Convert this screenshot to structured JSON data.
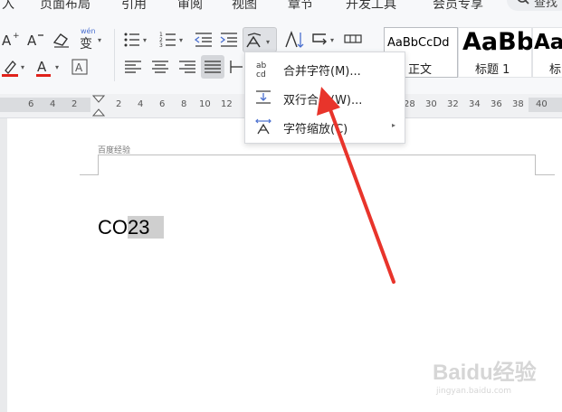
{
  "menu": {
    "items": [
      "入",
      "页面布局",
      "引用",
      "审阅",
      "视图",
      "章节",
      "开发工具",
      "会员专享"
    ],
    "search_label": "查找"
  },
  "toolbar": {
    "wen_label": "wén",
    "wen_char": "变",
    "icons": [
      "font-grow-icon",
      "font-shrink-icon",
      "clear-format-icon",
      "phonetic-guide-icon",
      "bullet-list-icon",
      "numbered-list-icon",
      "decrease-indent-icon",
      "increase-indent-icon",
      "chinese-layout-icon",
      "sort-icon",
      "line-spacing-icon",
      "table-icon",
      "highlight-icon",
      "font-color-icon",
      "char-border-icon",
      "align-left-icon",
      "align-center-icon",
      "align-right-icon",
      "justify-icon",
      "distributed-icon"
    ],
    "font_color": "#e0211a",
    "highlight_color": "#e0211a"
  },
  "styles": [
    {
      "preview": "AaBbCcDd",
      "name": "正文"
    },
    {
      "preview": "AaBb",
      "name": "标题 1"
    },
    {
      "preview": "Aa",
      "name": "标"
    }
  ],
  "ruler": {
    "numbers": [
      "6",
      "4",
      "2",
      "2",
      "4",
      "6",
      "8",
      "10",
      "12",
      "28",
      "30",
      "32",
      "34",
      "36",
      "38",
      "40"
    ]
  },
  "document": {
    "header_label": "百度经验",
    "text_plain": "CO",
    "text_highlighted": "23"
  },
  "dropdown": {
    "items": [
      {
        "label": "合并字符(M)...",
        "icon": "combine-characters-icon"
      },
      {
        "label": "双行合一(W)...",
        "icon": "two-lines-in-one-icon"
      },
      {
        "label": "字符缩放(C)",
        "icon": "character-scaling-icon",
        "has_submenu": true
      }
    ],
    "submenu_arrow": "▸"
  },
  "annotation": {
    "color": "#e8342b"
  },
  "watermark": {
    "logo": "Baidu经验",
    "url": "jingyan.baidu.com"
  }
}
